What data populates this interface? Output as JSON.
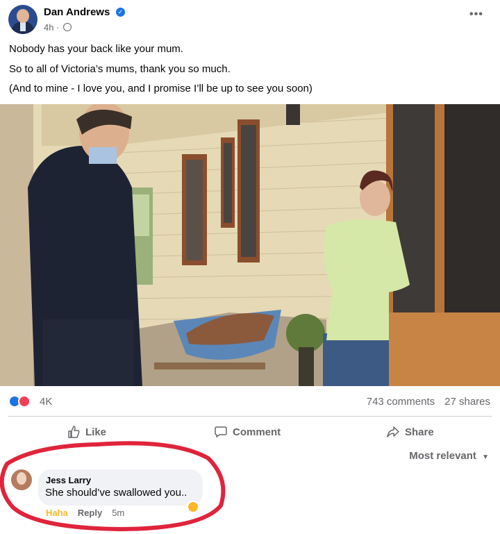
{
  "post": {
    "author": "Dan Andrews",
    "time": "4h ·",
    "more_label": "•••",
    "lines": [
      "Nobody has your back like your mum.",
      "So to all of Victoria’s mums, thank you so much.",
      "(And to mine - I love you, and I promise I’ll be up to see you soon)"
    ]
  },
  "engagement": {
    "reaction_count": "4K",
    "comments": "743 comments",
    "shares": "27 shares"
  },
  "actions": {
    "like": "Like",
    "comment": "Comment",
    "share": "Share"
  },
  "sort_label": "Most relevant",
  "comment": {
    "author": "Jess Larry",
    "text": "She should’ve swallowed you..",
    "haha": "Haha",
    "reply": "Reply",
    "time": "5m"
  },
  "colors": {
    "facebook_blue": "#1b74e4",
    "love_red": "#f33e58",
    "haha_yellow": "#f7b928",
    "annotation_red": "#e0243c",
    "secondary_text": "#65676b"
  }
}
